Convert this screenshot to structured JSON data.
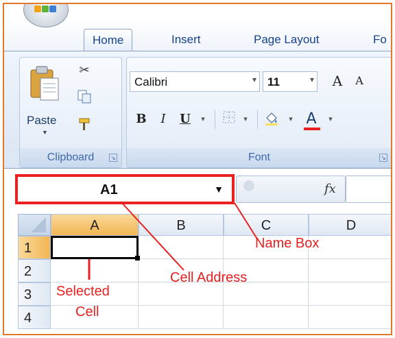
{
  "ribbon_tabs": [
    "Home",
    "Insert",
    "Page Layout",
    "Fo"
  ],
  "clipboard": {
    "paste_label": "Paste",
    "group_label": "Clipboard",
    "icons": [
      "paste-icon",
      "scissors-icon",
      "copy-icon",
      "format-painter-icon"
    ]
  },
  "font": {
    "font_name": "Calibri",
    "font_size": "11",
    "group_label": "Font",
    "grow_label": "A",
    "shrink_label": "A",
    "bold": "B",
    "italic": "I",
    "underline": "U",
    "font_color_label": "A",
    "font_color": "#e8201f"
  },
  "formula_bar": {
    "name_box_value": "A1",
    "fx_label": "fx"
  },
  "grid": {
    "columns": [
      "A",
      "B",
      "C",
      "D"
    ],
    "rows": [
      "1",
      "2",
      "3",
      "4"
    ],
    "selected_column": "A",
    "selected_row": "1"
  },
  "annotations": {
    "name_box": "Name Box",
    "cell_address": "Cell Address",
    "selected_cell_line1": "Selected",
    "selected_cell_line2": "Cell",
    "color": "#e8201f"
  }
}
